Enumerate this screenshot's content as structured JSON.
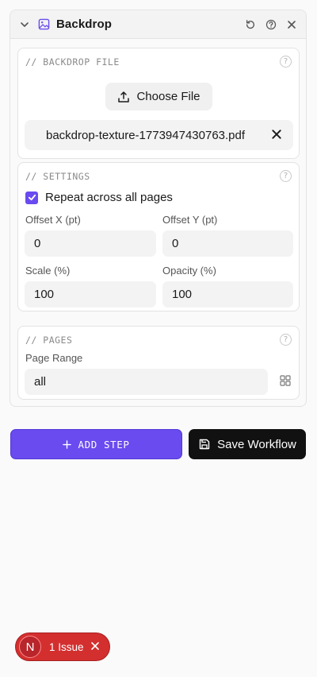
{
  "panel": {
    "title": "Backdrop",
    "icons": {
      "collapse": "chevron-down-icon",
      "image": "image-icon",
      "reset": "reset-icon",
      "help": "help-circle-icon",
      "close": "close-icon"
    }
  },
  "file_section": {
    "label": "// BACKDROP FILE",
    "help": "?",
    "choose_label": "Choose File",
    "file_name": "backdrop-texture-1773947430763.pdf"
  },
  "settings_section": {
    "label": "// SETTINGS",
    "help": "?",
    "repeat_label": "Repeat across all pages",
    "repeat_checked": true,
    "offset_x_label": "Offset X (pt)",
    "offset_x_value": "0",
    "offset_y_label": "Offset Y (pt)",
    "offset_y_value": "0",
    "scale_label": "Scale (%)",
    "scale_value": "100",
    "opacity_label": "Opacity (%)",
    "opacity_value": "100"
  },
  "pages_section": {
    "label": "// PAGES",
    "help": "?",
    "range_label": "Page Range",
    "range_value": "all"
  },
  "actions": {
    "add_step": "ADD STEP",
    "save_workflow": "Save Workflow"
  },
  "issue_indicator": {
    "badge": "N",
    "text": "1 Issue"
  },
  "colors": {
    "accent": "#6a4bf0",
    "dark_button": "#111111",
    "issue_red": "#d32f2f"
  }
}
